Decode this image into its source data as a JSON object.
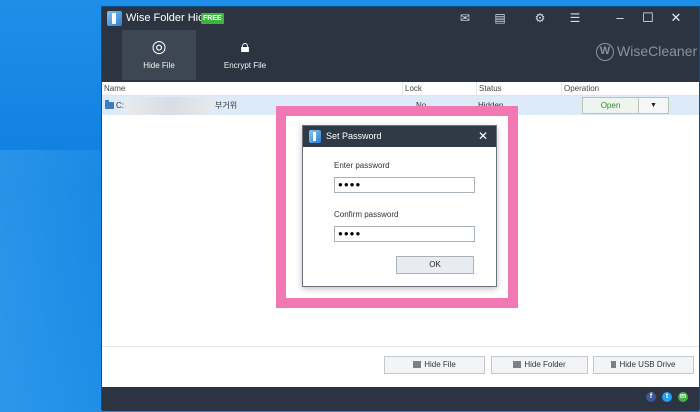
{
  "app": {
    "title": "Wise Folder Hider",
    "badge": "FREE",
    "brand": "WiseCleaner",
    "brand_mark": "W"
  },
  "titlebar_icons": [
    "mail-icon",
    "feedback-icon",
    "settings-icon",
    "menu-icon"
  ],
  "window_controls": {
    "minimize": "–",
    "maximize": "☐",
    "close": "✕"
  },
  "toolbar": {
    "hide_file": "Hide File",
    "encrypt_file": "Encrypt File"
  },
  "table": {
    "headers": {
      "name": "Name",
      "lock": "Lock",
      "status": "Status",
      "operation": "Operation"
    },
    "rows": [
      {
        "name_prefix": "C:\\",
        "name_suffix": "부거위",
        "lock": "No",
        "status": "Hidden",
        "operation": "Open",
        "dropdown": "▼"
      }
    ]
  },
  "bottom_buttons": {
    "hide_file": "Hide File",
    "hide_folder": "Hide Folder",
    "hide_usb": "Hide USB Drive"
  },
  "dialog": {
    "title": "Set Password",
    "close": "✕",
    "enter_label": "Enter password",
    "enter_value": "●●●●",
    "confirm_label": "Confirm password",
    "confirm_value": "●●●●",
    "ok": "OK"
  },
  "social": [
    "f",
    "t",
    "m"
  ],
  "colors": {
    "titlebar": "#2b3440",
    "highlight": "#f278b4",
    "free_badge": "#3fb53f",
    "open_text": "#2e8a2e"
  }
}
